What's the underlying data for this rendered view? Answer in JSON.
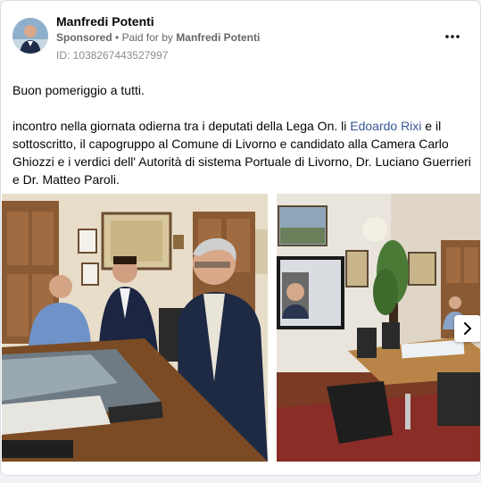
{
  "post": {
    "author": "Manfredi Potenti",
    "sponsored_label": "Sponsored",
    "separator": "•",
    "paid_for_prefix": "Paid for by",
    "paid_for_by": "Manfredi Potenti",
    "id_line": "ID: 1038267443527997",
    "greeting": "Buon pomeriggio a tutti.",
    "body_part1": "incontro nella giornata odierna tra i deputati della Lega On. li ",
    "body_link": "Edoardo Rixi",
    "body_part2": " e il sottoscritto, il capogruppo al Comune di Livorno e candidato alla Camera Carlo Ghiozzi e i verdici dell' Autorità di sistema Portuale di Livorno, Dr. Luciano Guerrieri e Dr. Matteo Paroli."
  },
  "icons": {
    "more": "more-dots-icon",
    "next": "chevron-right-icon"
  },
  "colors": {
    "link": "#385898",
    "secondary_text": "#65676b",
    "card_border": "#dadde1"
  }
}
